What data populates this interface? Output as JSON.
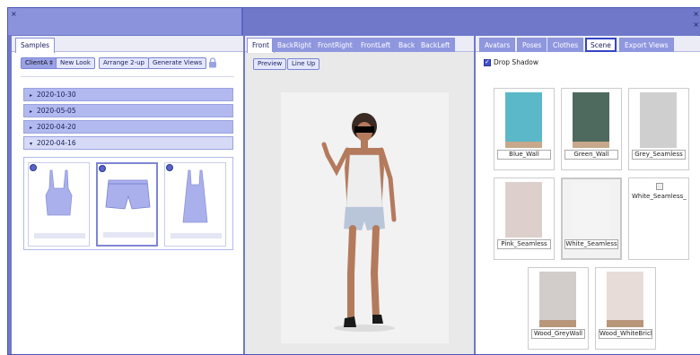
{
  "window": {
    "close_glyph": "×",
    "corner_glyph": "×",
    "corner_glyph2": "×"
  },
  "left": {
    "tab": "Samples",
    "toolbar": {
      "client": "ClientA ‡",
      "new_look": "New Look",
      "arrange": "Arrange 2-up",
      "generate": "Generate Views"
    },
    "lock_icon": "lock-icon",
    "dates": [
      {
        "label": "2020-10-30",
        "state": "collapsed"
      },
      {
        "label": "2020-05-05",
        "state": "collapsed"
      },
      {
        "label": "2020-04-20",
        "state": "collapsed"
      },
      {
        "label": "2020-04-16",
        "state": "expanded"
      }
    ],
    "collapsed_glyph": "▸",
    "expanded_glyph": "▾",
    "gallery_items": [
      "camisole",
      "shorts",
      "slip-dress"
    ]
  },
  "middle": {
    "tabs": [
      "Front",
      "BackRight",
      "FrontRight",
      "FrontLeft",
      "Back",
      "BackLeft"
    ],
    "active_tab": "Front",
    "buttons": {
      "preview": "Preview",
      "line_up": "Line Up"
    }
  },
  "right": {
    "tabs": [
      "Avatars",
      "Poses",
      "Clothes",
      "Scene",
      "Export Views"
    ],
    "active_tab": "Scene",
    "drop_shadow_label": "Drop Shadow",
    "drop_shadow_checked": true,
    "scenes": [
      {
        "label": "Blue_Wall",
        "color": "#5bb8c8",
        "floor": "#c8a88a"
      },
      {
        "label": "Green_Wall",
        "color": "#4e6a5e",
        "floor": "#c8a88a"
      },
      {
        "label": "Grey_Seamless",
        "color": "#cfcfcf",
        "floor": ""
      },
      {
        "label": "Pink_Seamless",
        "color": "#ddd0cc",
        "floor": ""
      },
      {
        "label": "White_Seamless",
        "color": "#f4f4f4",
        "floor": ""
      },
      {
        "label": "White_Seamless_",
        "color": "",
        "floor": ""
      },
      {
        "label": "Wood_GreyWall",
        "color": "#d2ccca",
        "floor": "#b8967a"
      },
      {
        "label": "Wood_WhiteBrick",
        "color": "#e8dcd8",
        "floor": "#b8967a"
      }
    ]
  },
  "colors": {
    "accent": "#6f78c9",
    "tab_inactive": "#8f97df",
    "selected_outline": "#3346c8"
  }
}
